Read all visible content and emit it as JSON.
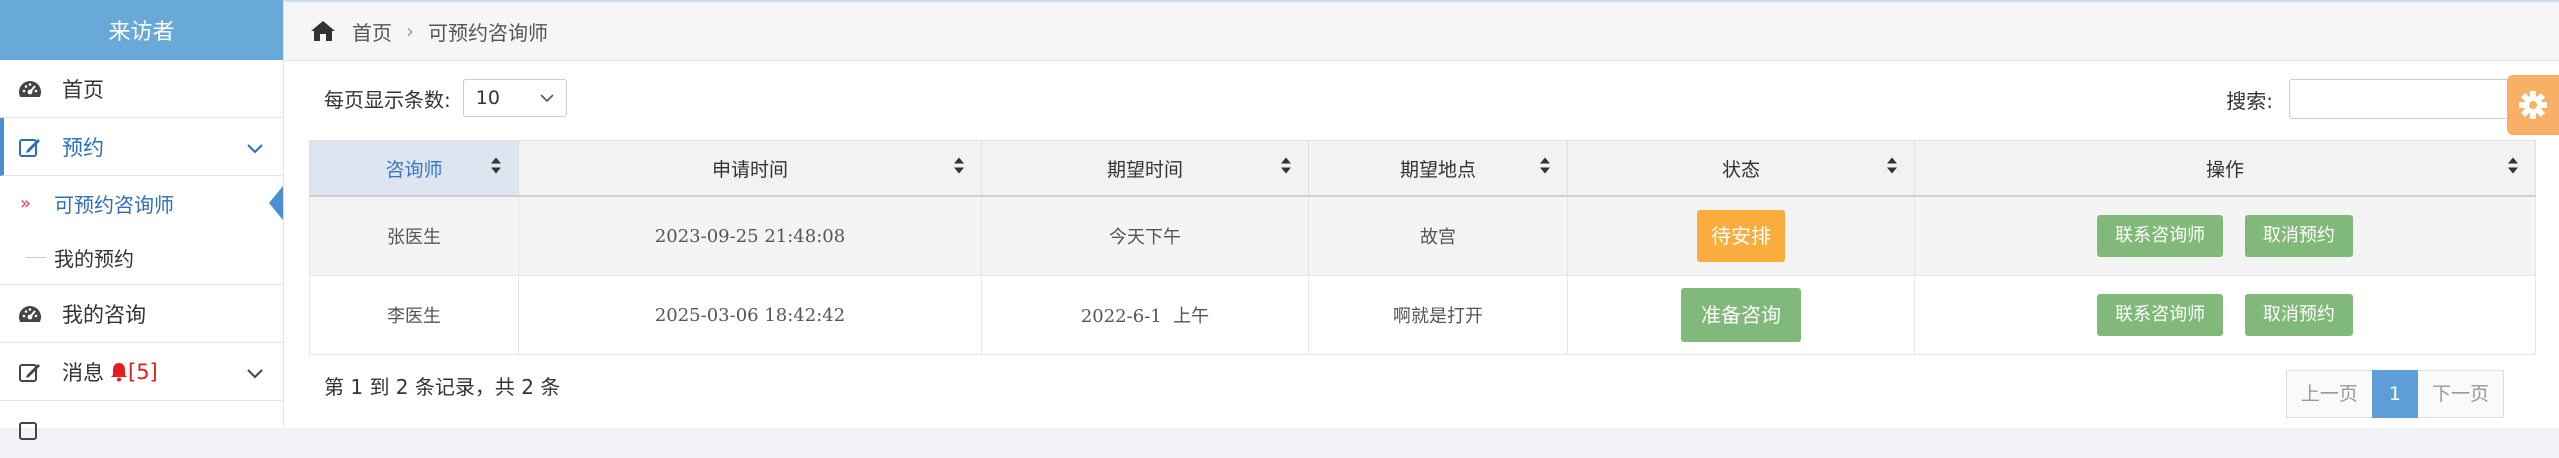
{
  "sidebar": {
    "brand": "来访者",
    "items": [
      {
        "label": "首页",
        "icon": "dashboard-icon"
      },
      {
        "label": "预约",
        "icon": "edit-icon"
      },
      {
        "label": "我的咨询",
        "icon": "dashboard-icon"
      },
      {
        "label": "消息",
        "icon": "edit-icon",
        "badge": "[5]"
      }
    ],
    "submenu": [
      {
        "label": "可预约咨询师",
        "mark": "»"
      },
      {
        "label": "我的预约"
      }
    ]
  },
  "breadcrumb": {
    "home": "首页",
    "separator": "›",
    "current": "可预约咨询师"
  },
  "controls": {
    "page_size_label": "每页显示条数:",
    "page_size_value": "10",
    "search_label": "搜索:",
    "search_value": ""
  },
  "table": {
    "columns": [
      "咨询师",
      "申请时间",
      "期望时间",
      "期望地点",
      "状态",
      "操作"
    ],
    "rows": [
      {
        "counselor": "张医生",
        "apply_time": "2023-09-25 21:48:08",
        "expect_time": "今天下午",
        "place": "故宫",
        "status": "待安排"
      },
      {
        "counselor": "李医生",
        "apply_time": "2025-03-06 18:42:42",
        "expect_time": "2022-6-1  上午",
        "place": "啊就是打开",
        "status": "准备咨询"
      }
    ],
    "actions": {
      "contact": "联系咨询师",
      "cancel": "取消预约"
    }
  },
  "footer": {
    "info": "第 1 到 2 条记录，共 2 条",
    "prev": "上一页",
    "page": "1",
    "next": "下一页"
  },
  "colors": {
    "brand": "#69a9d8",
    "pending": "#f8ad3e",
    "ready": "#80b97a",
    "pager_active": "#5e9ed6"
  }
}
